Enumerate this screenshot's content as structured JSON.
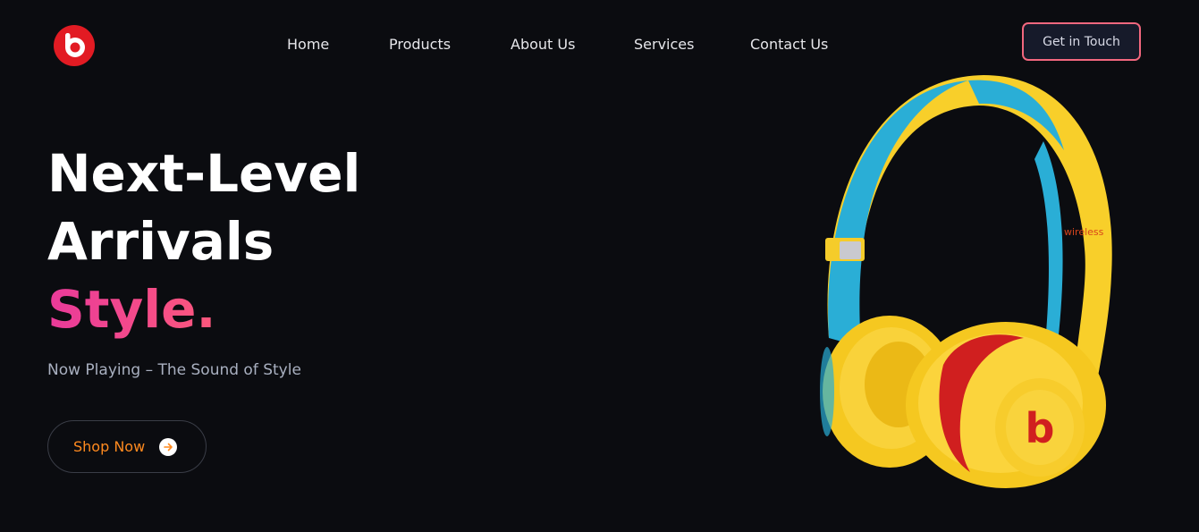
{
  "brand": {
    "logo_letter": "b",
    "logo_color": "#e21b23"
  },
  "nav": {
    "items": [
      "Home",
      "Products",
      "About Us",
      "Services",
      "Contact Us"
    ]
  },
  "header": {
    "cta_label": "Get in Touch",
    "cta_border_color": "#f2677e"
  },
  "hero": {
    "title_line1": "Next-Level",
    "title_line2": "Arrivals",
    "title_accent": "Style.",
    "accent_gradient": [
      "#e93a9a",
      "#ff6f5e"
    ],
    "subtitle": "Now Playing – The Sound of Style",
    "shop_label": "Shop Now",
    "shop_icon": "arrow-right-icon",
    "shop_color": "#ff8a1f"
  },
  "product_image": {
    "band_text": "wireless",
    "cup_logo": "b",
    "colors": {
      "yellow": "#f8cf2a",
      "blue": "#2aaed6",
      "red": "#d01f1f"
    }
  }
}
